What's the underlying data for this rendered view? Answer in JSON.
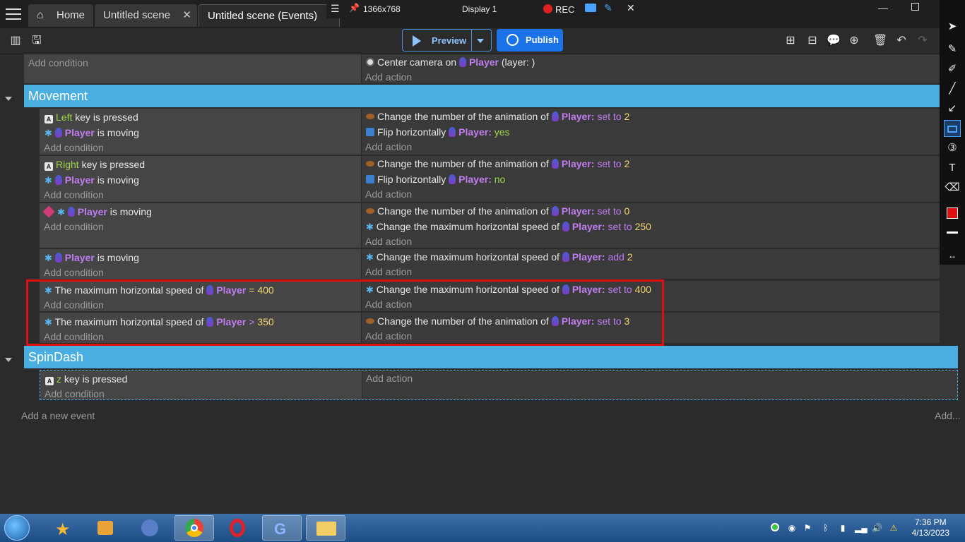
{
  "tabs": [
    {
      "label": "Home"
    },
    {
      "label": "Untitled scene"
    },
    {
      "label": "Untitled scene (Events)"
    }
  ],
  "recorder": {
    "resolution": "1366x768",
    "display": "Display 1",
    "rec": "REC"
  },
  "toolbar": {
    "preview": "Preview",
    "publish": "Publish"
  },
  "events": {
    "top": {
      "cond_add": "Add condition",
      "act1_pre": "Center camera on",
      "act1_obj": "Player",
      "act1_post": "(layer: )",
      "act_add": "Add action"
    },
    "groups": {
      "movement": "Movement",
      "spindash": "SpinDash"
    },
    "e1": {
      "c1_key": "Left",
      "c1_text": "key is pressed",
      "c2_obj": "Player",
      "c2_text": "is moving",
      "a1_text": "Change the number of the animation of",
      "a1_obj": "Player:",
      "a1_op": "set to",
      "a1_val": "2",
      "a2_text": "Flip horizontally",
      "a2_obj": "Player:",
      "a2_val": "yes"
    },
    "e2": {
      "c1_key": "Right",
      "c1_text": "key is pressed",
      "c2_obj": "Player",
      "c2_text": "is moving",
      "a1_text": "Change the number of the animation of",
      "a1_obj": "Player:",
      "a1_op": "set to",
      "a1_val": "2",
      "a2_text": "Flip horizontally",
      "a2_obj": "Player:",
      "a2_val": "no"
    },
    "e3": {
      "c1_obj": "Player",
      "c1_text": "is moving",
      "a1_text": "Change the number of the animation of",
      "a1_obj": "Player:",
      "a1_op": "set to",
      "a1_val": "0",
      "a2_text": "Change the maximum horizontal speed of",
      "a2_obj": "Player:",
      "a2_op": "set to",
      "a2_val": "250"
    },
    "e4": {
      "c1_obj": "Player",
      "c1_text": "is moving",
      "a1_text": "Change the maximum horizontal speed of",
      "a1_obj": "Player:",
      "a1_op": "add",
      "a1_val": "2"
    },
    "e5": {
      "c1_text": "The maximum horizontal speed of",
      "c1_obj": "Player",
      "c1_op": "=",
      "c1_val": "400",
      "a1_text": "Change the maximum horizontal speed of",
      "a1_obj": "Player:",
      "a1_op": "set to",
      "a1_val": "400"
    },
    "e6": {
      "c1_text": "The maximum horizontal speed of",
      "c1_obj": "Player",
      "c1_op": ">",
      "c1_val": "350",
      "a1_text": "Change the number of the animation of",
      "a1_obj": "Player:",
      "a1_op": "set to",
      "a1_val": "3"
    },
    "e7": {
      "c1_key": "z",
      "c1_text": "key is pressed"
    },
    "add_condition": "Add condition",
    "add_action": "Add action",
    "add_new_event": "Add a new event",
    "add_other": "Add..."
  },
  "clock": {
    "time": "7:36 PM",
    "date": "4/13/2023"
  },
  "colors": {
    "group_header": "#4aaee0",
    "highlight": "#e01010",
    "publish": "#1a73e8"
  }
}
